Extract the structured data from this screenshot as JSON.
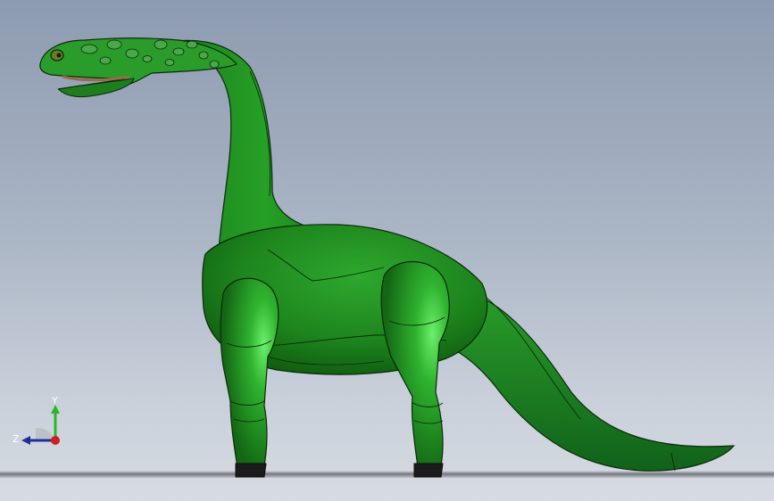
{
  "viewport": {
    "background_top": "#8d9bb0",
    "background_bottom": "#d7dbe2"
  },
  "model": {
    "body_color": "#1f8a1f",
    "highlight_color": "#5ee85e",
    "shadow_color": "#0e4a0e",
    "edge_color": "#0a2a0a",
    "spot_color": "#3c9a3c"
  },
  "triad": {
    "y_label": "Y",
    "z_label": "Z",
    "y_color": "#2bb52b",
    "z_color": "#1e2f9a",
    "x_color": "#d01f1f"
  }
}
